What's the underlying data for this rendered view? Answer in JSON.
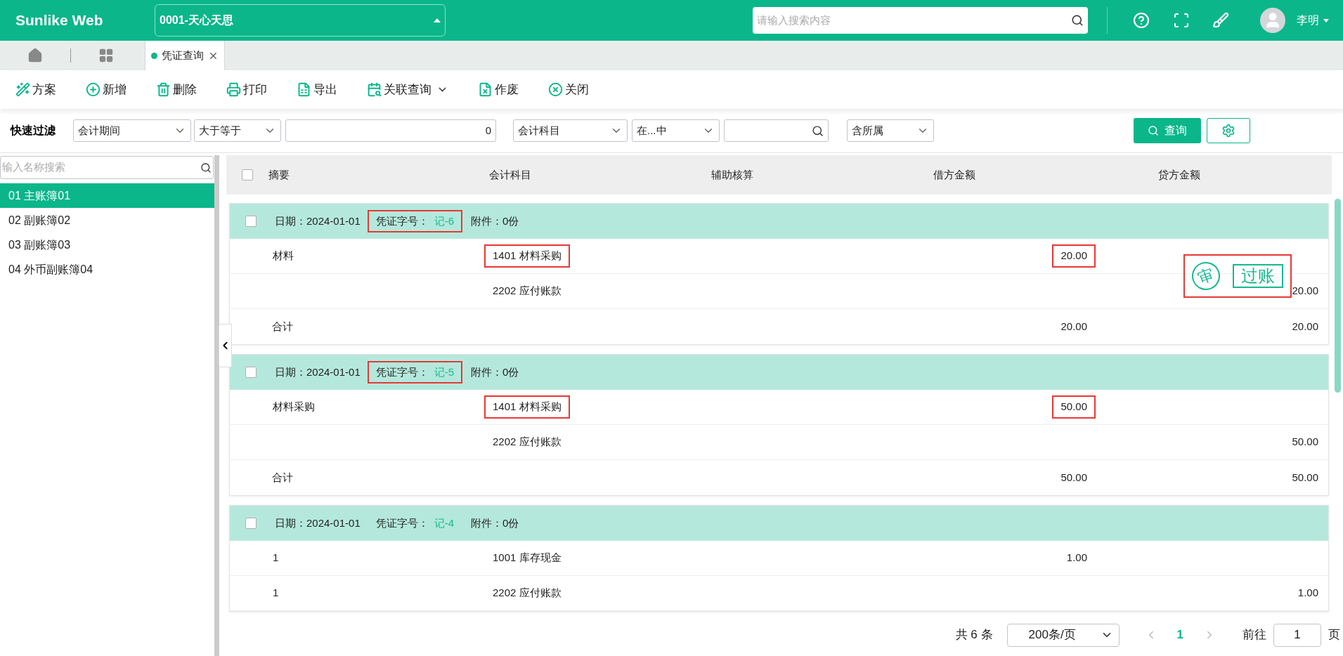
{
  "header": {
    "logo": "Sunlike Web",
    "company": "0001-天心天思",
    "search_placeholder": "请输入搜索内容",
    "user": "李明"
  },
  "tabs": [
    {
      "label": "凭证查询",
      "selected": true
    }
  ],
  "toolbar": [
    {
      "kind": "scheme",
      "label": "方案"
    },
    {
      "kind": "add",
      "label": "新增"
    },
    {
      "kind": "delete",
      "label": "删除"
    },
    {
      "kind": "print",
      "label": "打印"
    },
    {
      "kind": "export",
      "label": "导出"
    },
    {
      "kind": "related",
      "label": "关联查询",
      "dropdown": true
    },
    {
      "kind": "void",
      "label": "作废"
    },
    {
      "kind": "close",
      "label": "关闭"
    }
  ],
  "filter": {
    "label": "快速过滤",
    "fields": [
      {
        "kind": "select",
        "value": "会计期间"
      },
      {
        "kind": "select",
        "value": "大于等于"
      },
      {
        "kind": "input",
        "value": "0"
      },
      {
        "kind": "select",
        "value": "会计科目"
      },
      {
        "kind": "select",
        "value": "在...中"
      },
      {
        "kind": "search"
      },
      {
        "kind": "select",
        "value": "含所属"
      }
    ],
    "query": "查询"
  },
  "sidebar": {
    "search_placeholder": "输入名称搜索",
    "items": [
      {
        "label": "01 主账簿01",
        "selected": true
      },
      {
        "label": "02 副账簿02",
        "selected": false
      },
      {
        "label": "03 副账簿03",
        "selected": false
      },
      {
        "label": "04 外币副账簿04",
        "selected": false
      }
    ]
  },
  "table": {
    "all_checked": false,
    "columns": [
      "摘要",
      "会计科目",
      "辅助核算",
      "借方金额",
      "贷方金额"
    ],
    "vouchers": [
      {
        "checked": false,
        "date": "日期：2024-01-01",
        "number_label": "凭证字号：",
        "number": "记-6",
        "attachments": "附件：0份",
        "number_highlighted": true,
        "stamps": [
          {
            "kind": "audit",
            "text": "审"
          },
          {
            "kind": "posted",
            "text": "过账"
          }
        ],
        "stamps_highlighted": true,
        "lines": [
          {
            "summary": "材料",
            "account": "1401 材料采购",
            "debit": "20.00",
            "highlighted": true
          },
          {
            "account": "2202 应付账款",
            "credit": "20.00",
            "highlighted": false
          }
        ],
        "total": {
          "label": "合计",
          "debit": "20.00",
          "credit": "20.00"
        }
      },
      {
        "checked": false,
        "date": "日期：2024-01-01",
        "number_label": "凭证字号：",
        "number": "记-5",
        "attachments": "附件：0份",
        "number_highlighted": true,
        "lines": [
          {
            "summary": "材料采购",
            "account": "1401 材料采购",
            "debit": "50.00",
            "highlighted": true
          },
          {
            "account": "2202 应付账款",
            "credit": "50.00",
            "highlighted": false
          }
        ],
        "total": {
          "label": "合计",
          "debit": "50.00",
          "credit": "50.00"
        }
      },
      {
        "checked": false,
        "date": "日期：2024-01-01",
        "number_label": "凭证字号：",
        "number": "记-4",
        "attachments": "附件：0份",
        "number_highlighted": false,
        "lines": [
          {
            "summary": "1",
            "account": "1001 库存现金",
            "debit": "1.00",
            "highlighted": false
          },
          {
            "summary": "1",
            "account": "2202 应付账款",
            "credit": "1.00",
            "highlighted": false
          }
        ]
      }
    ]
  },
  "pagination": {
    "total": "共 6 条",
    "page_size": "200条/页",
    "pages": [
      {
        "label": "1",
        "selected": true
      }
    ],
    "goto_label": "前往",
    "goto_value": "1",
    "page_suffix": "页"
  }
}
